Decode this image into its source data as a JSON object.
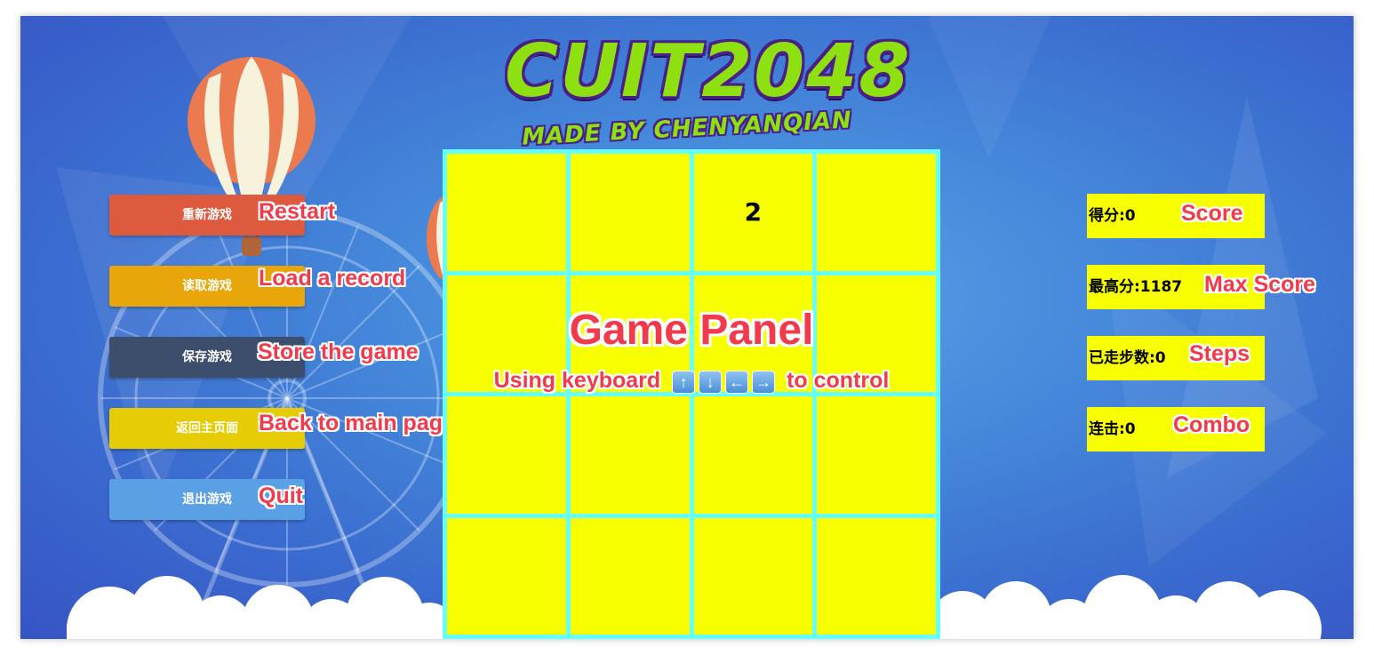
{
  "logo": {
    "title": "CUIT2048",
    "subtitle": "MADE BY CHENYANQIAN"
  },
  "buttons": [
    {
      "label": "重新游戏",
      "annotation": "Restart",
      "color": "#de5a3f"
    },
    {
      "label": "读取游戏",
      "annotation": "Load a record",
      "color": "#e8a60a"
    },
    {
      "label": "保存游戏",
      "annotation": "Store the game",
      "color": "#3d4e6c"
    },
    {
      "label": "返回主页面",
      "annotation": "Back to main page",
      "color": "#e6cc05"
    },
    {
      "label": "退出游戏",
      "annotation": "Quit",
      "color": "#5aa0e4"
    }
  ],
  "board": {
    "cells": [
      "",
      "",
      "2",
      "",
      "",
      "",
      "",
      "",
      "",
      "",
      "",
      "",
      "",
      "",
      "",
      ""
    ],
    "cell_color": "#f7ff00",
    "grid_color": "#66ffff",
    "annotation_title": "Game Panel",
    "annotation_sub_before": "Using keyboard",
    "annotation_sub_after": "to control",
    "keys": [
      "up-arrow-key-icon",
      "down-arrow-key-icon",
      "left-arrow-key-icon",
      "right-arrow-key-icon"
    ]
  },
  "stats": [
    {
      "label": "得分:0",
      "annotation": "Score"
    },
    {
      "label": "最高分:1187",
      "annotation": "Max Score"
    },
    {
      "label": "已走步数:0",
      "annotation": "Steps"
    },
    {
      "label": "连击:0",
      "annotation": "Combo"
    }
  ],
  "colors": {
    "annotation": "#f23a4d",
    "background": "#4589db"
  }
}
